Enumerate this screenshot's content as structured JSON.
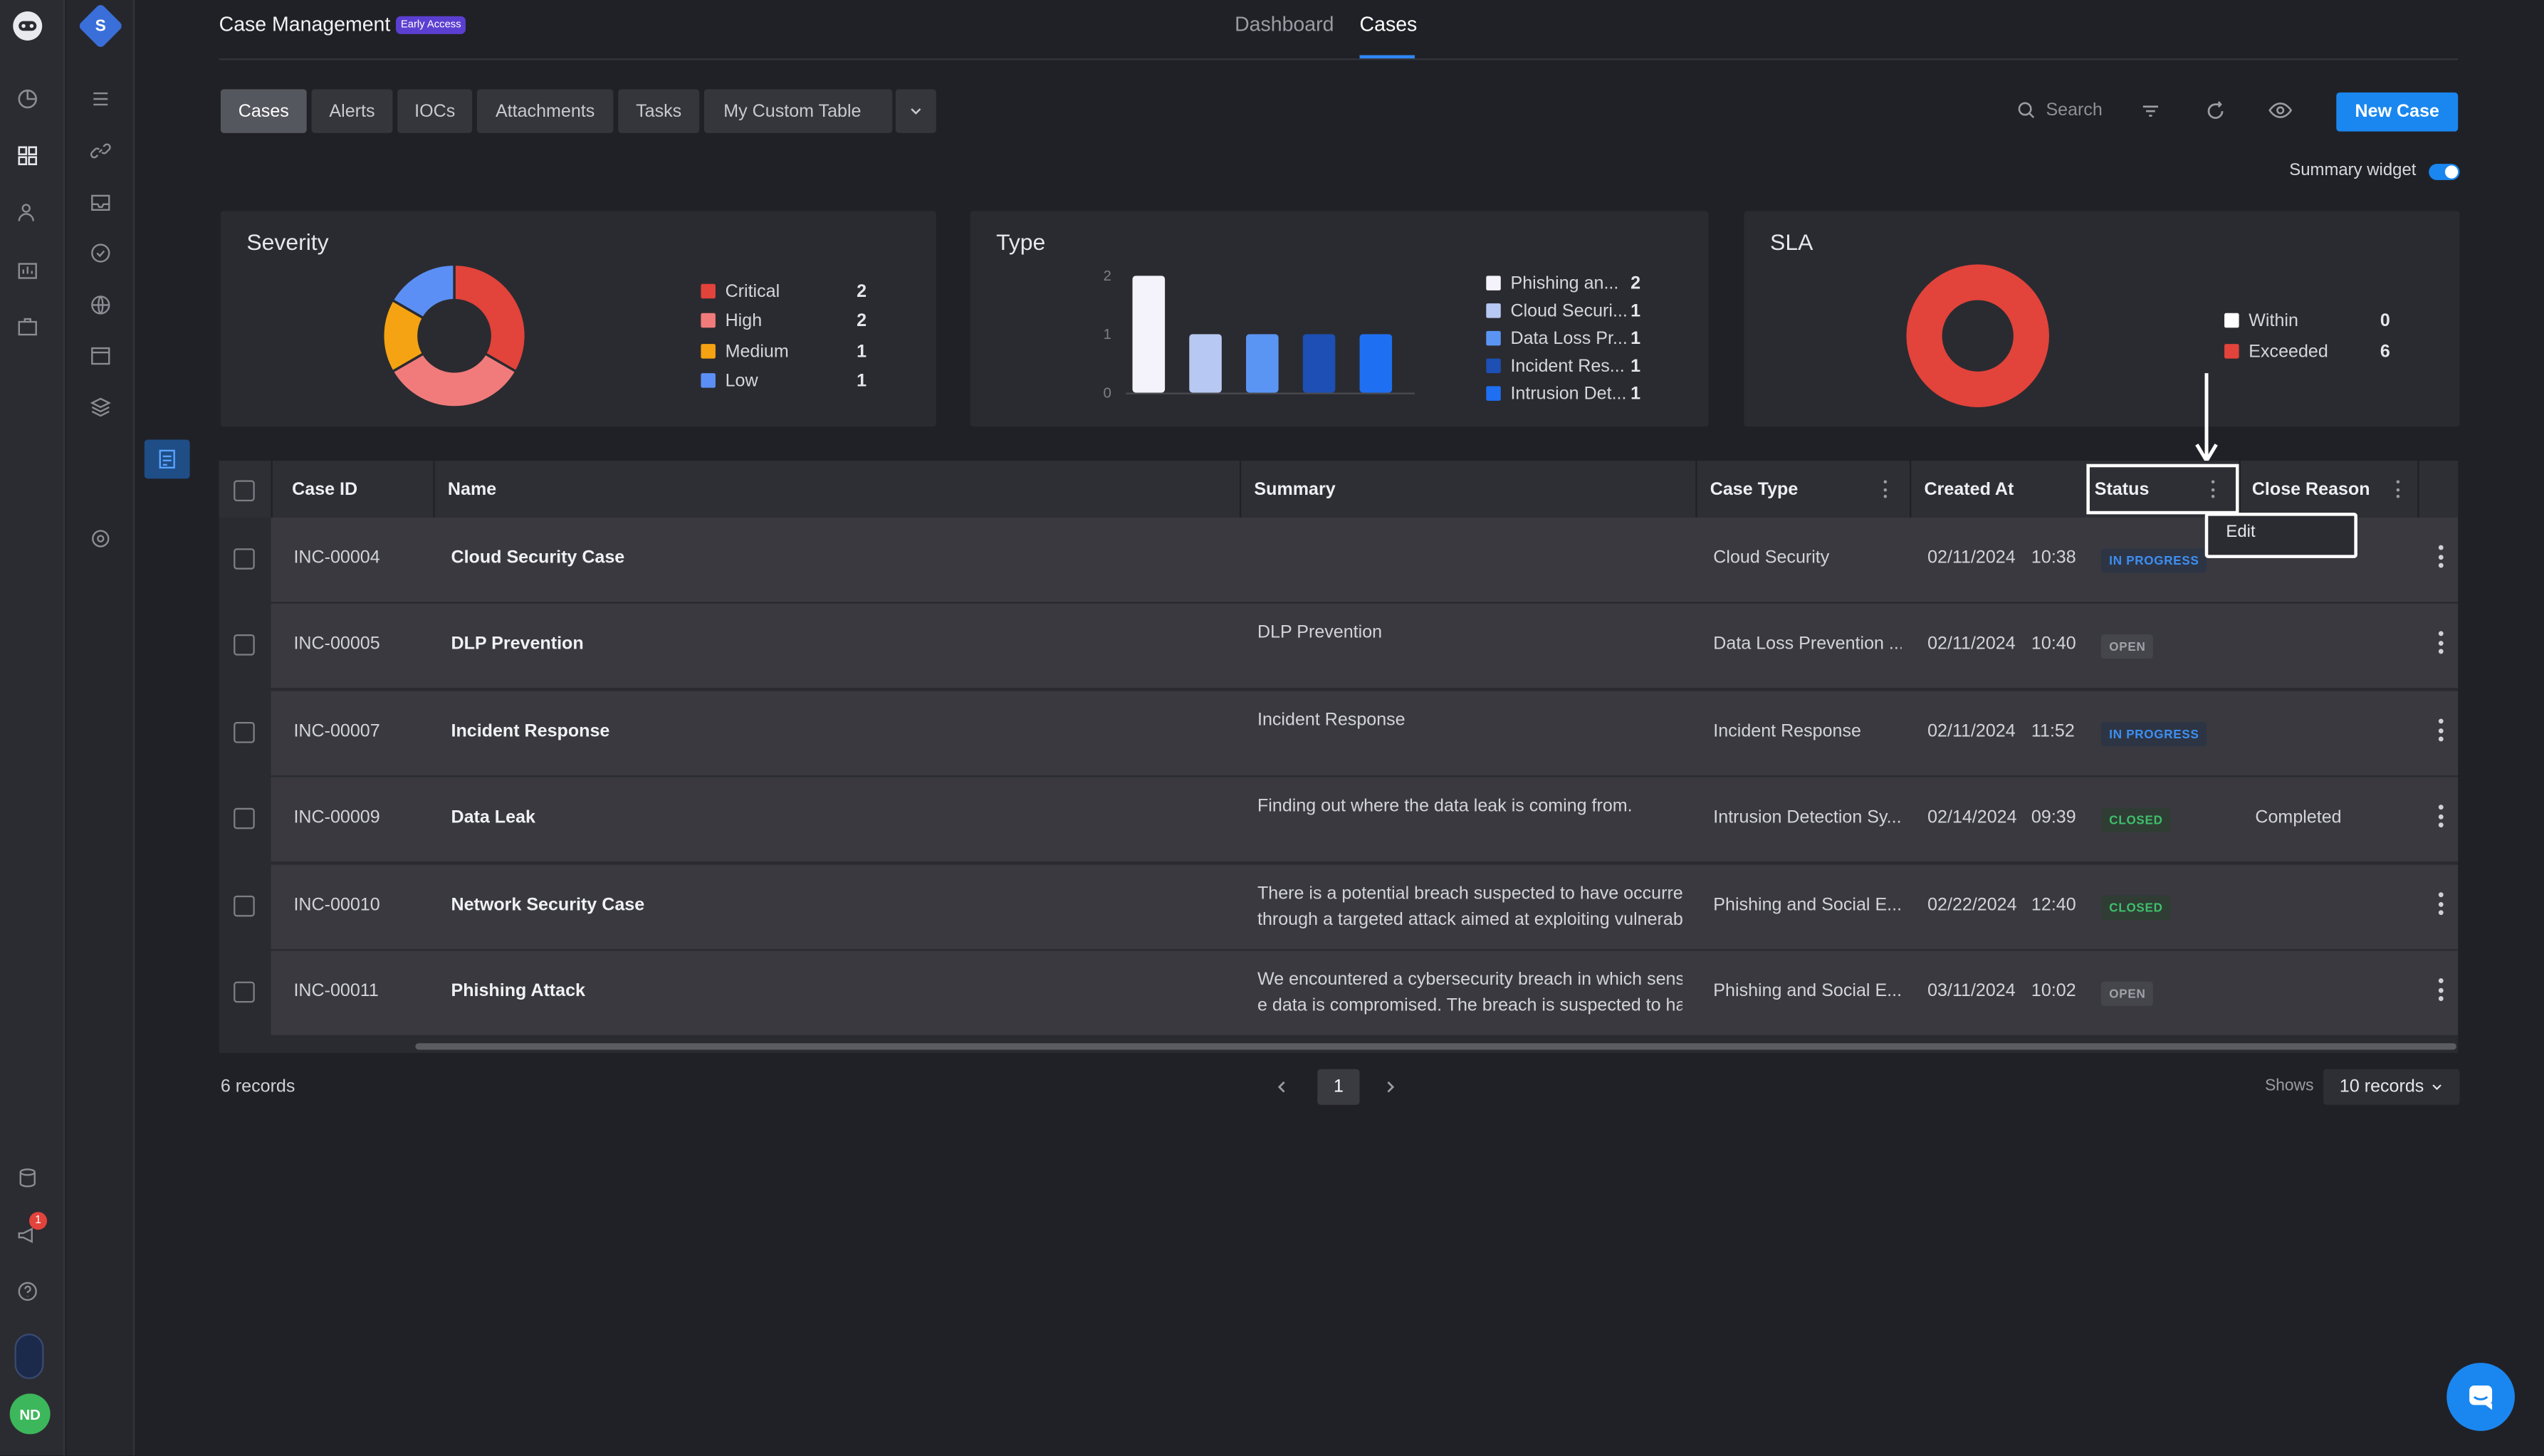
{
  "header": {
    "title": "Case Management",
    "badge": "Early Access",
    "tabs": [
      {
        "label": "Dashboard"
      },
      {
        "label": "Cases"
      }
    ]
  },
  "user": {
    "initials": "ND",
    "notifications": "1",
    "workspace": "S"
  },
  "segments": [
    {
      "label": "Cases"
    },
    {
      "label": "Alerts"
    },
    {
      "label": "IOCs"
    },
    {
      "label": "Attachments"
    },
    {
      "label": "Tasks"
    },
    {
      "label": "My Custom Table"
    }
  ],
  "toolbar": {
    "search_label": "Search",
    "new_case_label": "New Case",
    "summary_widget_label": "Summary widget"
  },
  "cards": {
    "severity": {
      "title": "Severity",
      "items": [
        {
          "label": "Critical",
          "value": "2",
          "color": "#e2433b"
        },
        {
          "label": "High",
          "value": "2",
          "color": "#f17b7b"
        },
        {
          "label": "Medium",
          "value": "1",
          "color": "#f5a312"
        },
        {
          "label": "Low",
          "value": "1",
          "color": "#5b8ff5"
        }
      ]
    },
    "type": {
      "title": "Type",
      "items": [
        {
          "label": "Phishing an...",
          "value": "2",
          "color": "#f4f2fa"
        },
        {
          "label": "Cloud Securi...",
          "value": "1",
          "color": "#b7c8f2"
        },
        {
          "label": "Data Loss Pr...",
          "value": "1",
          "color": "#5b95f4"
        },
        {
          "label": "Incident Res...",
          "value": "1",
          "color": "#1d4fb4"
        },
        {
          "label": "Intrusion Det...",
          "value": "1",
          "color": "#1f6ff2"
        }
      ]
    },
    "sla": {
      "title": "SLA",
      "items": [
        {
          "label": "Within",
          "value": "0",
          "color": "#ffffff"
        },
        {
          "label": "Exceeded",
          "value": "6",
          "color": "#e2433b"
        }
      ]
    }
  },
  "chart_data": [
    {
      "type": "pie",
      "title": "Severity",
      "categories": [
        "Critical",
        "High",
        "Medium",
        "Low"
      ],
      "values": [
        2,
        2,
        1,
        1
      ],
      "colors": [
        "#e2433b",
        "#f17b7b",
        "#f5a312",
        "#5b8ff5"
      ],
      "donut": true
    },
    {
      "type": "bar",
      "title": "Type",
      "categories": [
        "Phishing an...",
        "Cloud Securi...",
        "Data Loss Pr...",
        "Incident Res...",
        "Intrusion Det..."
      ],
      "values": [
        2,
        1,
        1,
        1,
        1
      ],
      "colors": [
        "#f4f2fa",
        "#b7c8f2",
        "#5b95f4",
        "#1d4fb4",
        "#1f6ff2"
      ],
      "ylim": [
        0,
        2
      ],
      "yticks": [
        "0",
        "1",
        "2"
      ]
    },
    {
      "type": "pie",
      "title": "SLA",
      "categories": [
        "Within",
        "Exceeded"
      ],
      "values": [
        0,
        6
      ],
      "colors": [
        "#ffffff",
        "#e2433b"
      ],
      "donut": true
    }
  ],
  "table": {
    "columns": [
      {
        "label": "Case ID"
      },
      {
        "label": "Name"
      },
      {
        "label": "Summary"
      },
      {
        "label": "Case Type"
      },
      {
        "label": "Created At"
      },
      {
        "label": "Status"
      },
      {
        "label": "Close Reason"
      }
    ],
    "status_menu": {
      "edit_label": "Edit"
    },
    "rows": [
      {
        "id": "INC-00004",
        "name": "Cloud Security Case",
        "summary1": "",
        "summary2": "",
        "case_type": "Cloud Security",
        "created_date": "02/11/2024",
        "created_time": "10:38",
        "status": "IN PROGRESS",
        "status_kind": "prog",
        "close_reason": ""
      },
      {
        "id": "INC-00005",
        "name": "DLP Prevention",
        "summary1": "DLP Prevention",
        "summary2": "",
        "case_type": "Data Loss Prevention ...",
        "created_date": "02/11/2024",
        "created_time": "10:40",
        "status": "OPEN",
        "status_kind": "open",
        "close_reason": ""
      },
      {
        "id": "INC-00007",
        "name": "Incident Response",
        "summary1": "Incident Response",
        "summary2": "",
        "case_type": "Incident Response",
        "created_date": "02/11/2024",
        "created_time": "11:52",
        "status": "IN PROGRESS",
        "status_kind": "prog",
        "close_reason": ""
      },
      {
        "id": "INC-00009",
        "name": "Data Leak",
        "summary1": "Finding out where the data leak is coming from.",
        "summary2": "",
        "case_type": "Intrusion Detection Sy...",
        "created_date": "02/14/2024",
        "created_time": "09:39",
        "status": "CLOSED",
        "status_kind": "closed",
        "close_reason": "Completed"
      },
      {
        "id": "INC-00010",
        "name": "Network Security Case",
        "summary1": "There is a potential breach suspected to have occurred",
        "summary2": "through a targeted attack aimed at exploiting vulnerab...",
        "case_type": "Phishing and Social E...",
        "created_date": "02/22/2024",
        "created_time": "12:40",
        "status": "CLOSED",
        "status_kind": "closed",
        "close_reason": ""
      },
      {
        "id": "INC-00011",
        "name": "Phishing Attack",
        "summary1": "We encountered a cybersecurity breach in which sensitiv",
        "summary2": "e data is compromised. The breach is suspected to ha...",
        "case_type": "Phishing and Social E...",
        "created_date": "03/11/2024",
        "created_time": "10:02",
        "status": "OPEN",
        "status_kind": "open",
        "close_reason": ""
      }
    ]
  },
  "footer": {
    "records": "6 records",
    "page": "1",
    "shows_label": "Shows",
    "per_page": "10 records"
  }
}
